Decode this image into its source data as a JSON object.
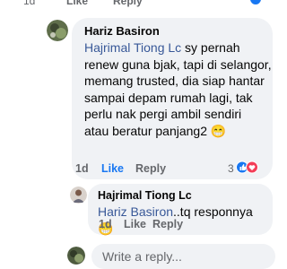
{
  "top_actions": {
    "time": "1d",
    "like": "Like",
    "reply": "Reply"
  },
  "comment": {
    "author": "Hariz Basiron",
    "mention": "Hajrimal Tiong Lc",
    "lines": [
      "sy pernah",
      "renew guna bjak, tapi di selangor,",
      "memang trusted, dia siap hantar",
      "sampai depam rumah lagi, tak",
      "perlu nak pergi ambil sendiri",
      "atau beratur panjang2"
    ],
    "emoji": "😁",
    "time": "1d",
    "like_label": "Like",
    "reply_label": "Reply",
    "reaction_count": "3"
  },
  "reply": {
    "author": "Hajrimal Tiong Lc",
    "mention": "Hariz Basiron",
    "text": "..tq responnya",
    "emoji": "😁",
    "time": "1d",
    "like_label": "Like",
    "reply_label": "Reply"
  },
  "composer": {
    "placeholder": "Write a reply..."
  },
  "colors": {
    "bubble": "#f0f2f5",
    "mention": "#385898",
    "like_active": "#1877f2",
    "secondary_text": "#65676b",
    "like_reaction": "#1877f2",
    "love_reaction": "#f33e58"
  },
  "icons": [
    "like-reaction-icon",
    "love-reaction-icon",
    "smiley-emoji"
  ]
}
